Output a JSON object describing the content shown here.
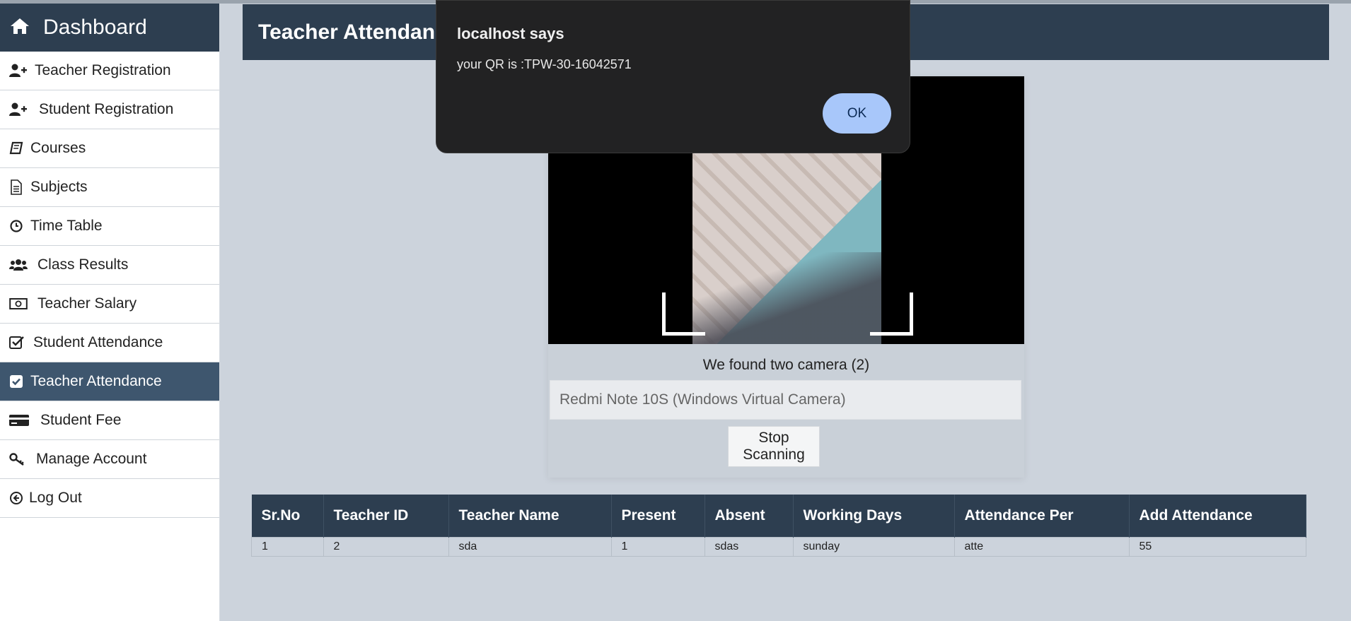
{
  "sidebar": {
    "header": {
      "title": "Dashboard",
      "icon": "home-icon"
    },
    "items": [
      {
        "label": "Teacher Registration",
        "icon": "user-plus-icon"
      },
      {
        "label": "Student Registration",
        "icon": "user-plus-icon"
      },
      {
        "label": "Courses",
        "icon": "book-icon"
      },
      {
        "label": "Subjects",
        "icon": "document-icon"
      },
      {
        "label": "Time Table",
        "icon": "clock-icon"
      },
      {
        "label": "Class Results",
        "icon": "users-icon"
      },
      {
        "label": "Teacher Salary",
        "icon": "money-icon"
      },
      {
        "label": "Student Attendance",
        "icon": "check-square-outline-icon"
      },
      {
        "label": "Teacher Attendance",
        "icon": "check-square-icon",
        "active": true
      },
      {
        "label": "Student Fee",
        "icon": "credit-card-icon"
      },
      {
        "label": "Manage Account",
        "icon": "key-icon"
      },
      {
        "label": "Log Out",
        "icon": "arrow-circle-left-icon"
      }
    ]
  },
  "main": {
    "title": "Teacher Attendance"
  },
  "scanner": {
    "camera_found": "We found two camera (2)",
    "camera_selected": "Redmi Note 10S (Windows Virtual Camera)",
    "stop_label": "Stop Scanning"
  },
  "table": {
    "headers": [
      "Sr.No",
      "Teacher ID",
      "Teacher Name",
      "Present",
      "Absent",
      "Working Days",
      "Attendance Per",
      "Add Attendance"
    ],
    "rows": [
      [
        "1",
        "2",
        "sda",
        "1",
        "sdas",
        "sunday",
        "atte",
        "55"
      ]
    ]
  },
  "dialog": {
    "title": "localhost says",
    "message": "your QR is :TPW-30-16042571",
    "ok_label": "OK"
  },
  "colors": {
    "header_bg": "#2d3e50",
    "active_item_bg": "#3e566e",
    "page_bg": "#ccd3dc",
    "ok_button": "#a8c7fa"
  }
}
